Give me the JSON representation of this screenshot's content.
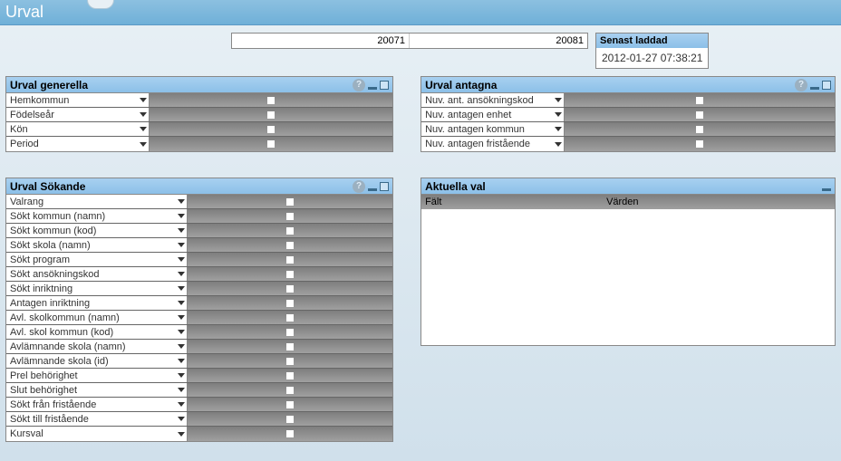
{
  "header": {
    "title": "Urval"
  },
  "year": {
    "from": "20071",
    "to": "20081"
  },
  "senast": {
    "label": "Senast laddad",
    "value": "2012-01-27 07:38:21"
  },
  "panel_generella": {
    "title": "Urval generella",
    "rows": [
      "Hemkommun",
      "Födelseår",
      "Kön",
      "Period"
    ]
  },
  "panel_antagna": {
    "title": "Urval antagna",
    "rows": [
      "Nuv. ant. ansökningskod",
      "Nuv. antagen enhet",
      "Nuv. antagen kommun",
      "Nuv. antagen fristående"
    ]
  },
  "panel_sokande": {
    "title": "Urval Sökande",
    "rows": [
      "Valrang",
      "Sökt kommun (namn)",
      "Sökt kommun (kod)",
      "Sökt skola (namn)",
      "Sökt program",
      "Sökt ansökningskod",
      "Sökt inriktning",
      "Antagen inriktning",
      "Avl. skolkommun (namn)",
      "Avl. skol kommun (kod)",
      "Avlämnande skola (namn)",
      "Avlämnande skola (id)",
      "Prel behörighet",
      "Slut behörighet",
      "Sökt från fristående",
      "Sökt till fristående",
      "Kursval"
    ]
  },
  "panel_aktuella": {
    "title": "Aktuella val",
    "col_field": "Fält",
    "col_values": "Värden"
  }
}
